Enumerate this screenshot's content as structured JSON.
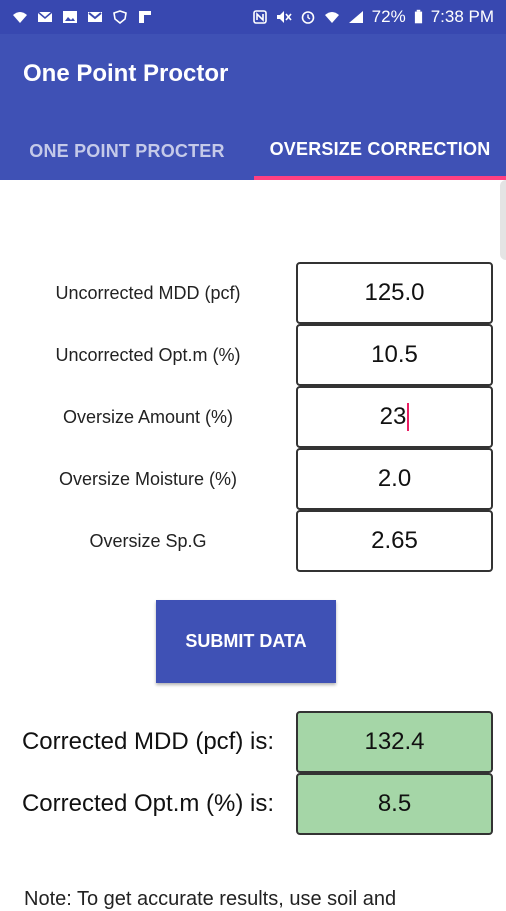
{
  "status_bar": {
    "battery": "72%",
    "time": "7:38 PM",
    "left_icons": [
      "wifi-calling-icon",
      "mail-icon",
      "photo-icon",
      "gmail-icon",
      "vpn-icon",
      "flipboard-icon"
    ],
    "right_icons": [
      "nfc-icon",
      "mute-icon",
      "alarm-icon",
      "wifi-icon",
      "signal-icon",
      "battery-icon"
    ]
  },
  "app": {
    "title": "One Point Proctor"
  },
  "tabs": [
    {
      "label": "ONE POINT PROCTER"
    },
    {
      "label": "OVERSIZE CORRECTION"
    }
  ],
  "form": {
    "fields": [
      {
        "label": "Uncorrected MDD (pcf)",
        "value": "125.0"
      },
      {
        "label": "Uncorrected Opt.m (%)",
        "value": "10.5"
      },
      {
        "label": "Oversize Amount (%)",
        "value": "23"
      },
      {
        "label": "Oversize Moisture (%)",
        "value": "2.0"
      },
      {
        "label": "Oversize Sp.G",
        "value": "2.65"
      }
    ],
    "submit_label": "SUBMIT DATA"
  },
  "results": [
    {
      "label": "Corrected MDD (pcf) is:",
      "value": "132.4"
    },
    {
      "label": "Corrected Opt.m (%) is:",
      "value": "8.5"
    }
  ],
  "note": "Note: To get accurate results, use soil and",
  "colors": {
    "primary": "#3f51b5",
    "accent": "#ff4081",
    "result_bg": "#a5d6a7"
  }
}
